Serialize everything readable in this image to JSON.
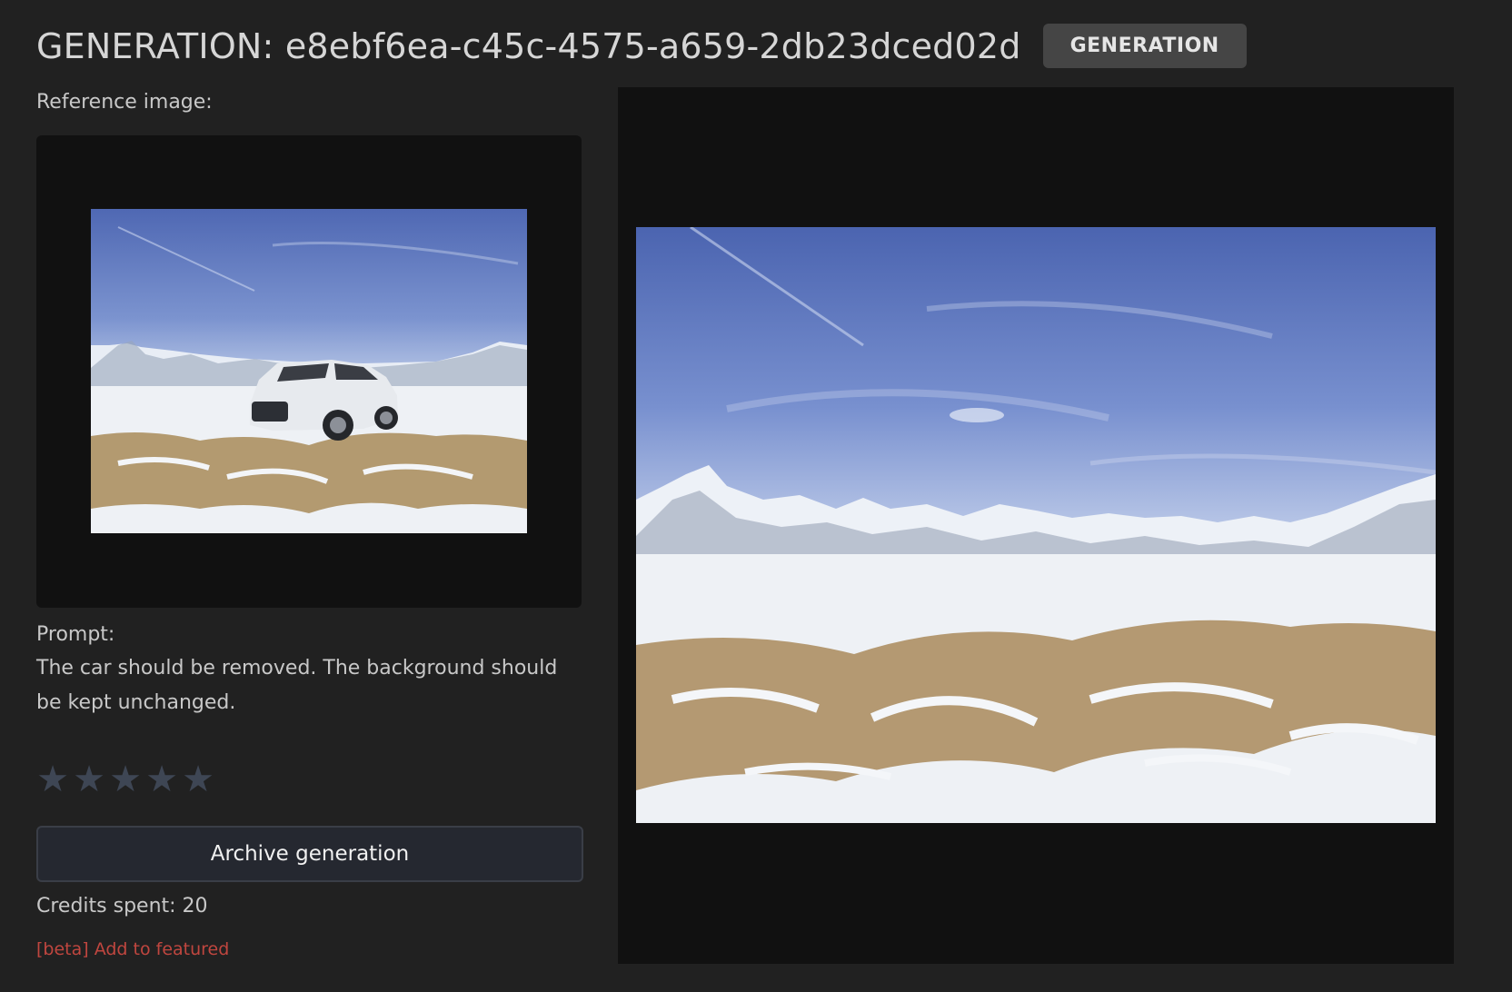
{
  "header": {
    "title": "GENERATION: e8ebf6ea-c45c-4575-a659-2db23dced02d",
    "badge": "GENERATION"
  },
  "reference": {
    "label": "Reference image:",
    "image_icon": "reference-photo-snow-mountains-with-white-suv"
  },
  "prompt": {
    "label": "Prompt:",
    "text": "The car should be removed. The background should be kept unchanged."
  },
  "rating": {
    "max": 5,
    "value": 0,
    "stars": [
      "★",
      "★",
      "★",
      "★",
      "★"
    ],
    "star_color": "#3e4654"
  },
  "actions": {
    "archive_label": "Archive generation",
    "featured_label": "[beta] Add to featured"
  },
  "credits": {
    "text": "Credits spent: 20"
  },
  "result": {
    "image_icon": "result-photo-snow-mountains-car-removed"
  },
  "colors": {
    "background": "#212121",
    "panel": "#111111",
    "badge_bg": "#454545",
    "link": "#c0463f"
  }
}
